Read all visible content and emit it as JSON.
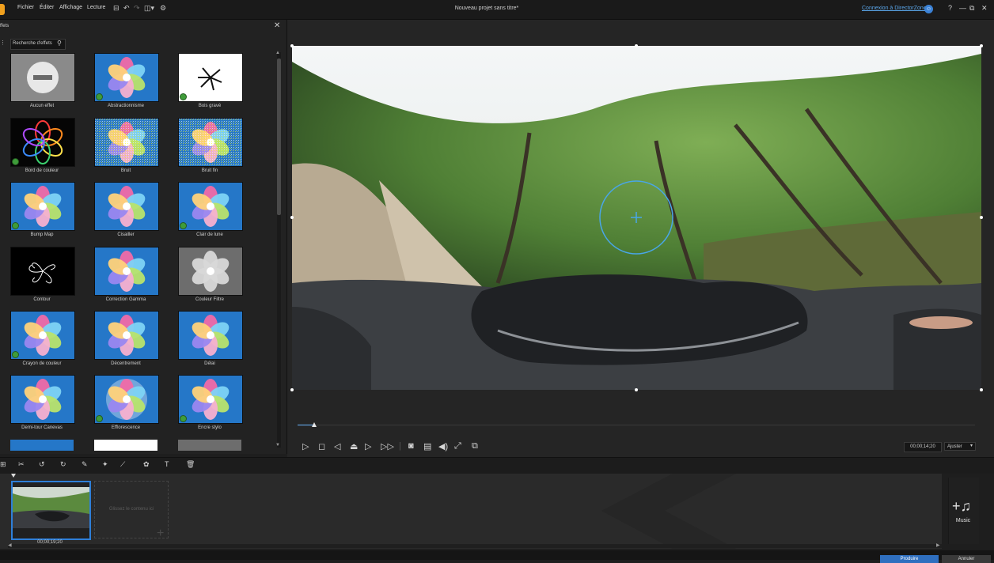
{
  "app": {
    "title": "Nouveau projet sans titre*",
    "menu": [
      "Fichier",
      "Éditer",
      "Affichage",
      "Lecture"
    ],
    "login_link": "Connexion à DirectorZone",
    "window_controls": {
      "help": "?",
      "minimize": "—",
      "restore": "⧉",
      "close": "✕"
    }
  },
  "effects_panel": {
    "title": "ffets",
    "search_placeholder": "Recherche d'effets",
    "items": [
      {
        "label": "Aucun effet",
        "icon": "no-effect-icon",
        "badge": false
      },
      {
        "label": "Abstractionnisme",
        "icon": "flower-thumb",
        "badge": true
      },
      {
        "label": "Bois gravé",
        "icon": "woodcut-thumb",
        "badge": true
      },
      {
        "label": "Bord de couleur",
        "icon": "color-edge-thumb",
        "badge": true
      },
      {
        "label": "Bruit",
        "icon": "noise-thumb",
        "badge": false
      },
      {
        "label": "Bruit fin",
        "icon": "fine-noise-thumb",
        "badge": false
      },
      {
        "label": "Bump Map",
        "icon": "flower-thumb",
        "badge": true
      },
      {
        "label": "Cisailler",
        "icon": "flower-thumb",
        "badge": false
      },
      {
        "label": "Clair de lune",
        "icon": "flower-thumb",
        "badge": true
      },
      {
        "label": "Contour",
        "icon": "contour-thumb",
        "badge": false
      },
      {
        "label": "Correction Gamma",
        "icon": "flower-thumb",
        "badge": false
      },
      {
        "label": "Couleur Filtre",
        "icon": "gray-flower-thumb",
        "badge": false
      },
      {
        "label": "Crayon de couleur",
        "icon": "flower-thumb",
        "badge": true
      },
      {
        "label": "Décentrement",
        "icon": "flower-thumb",
        "badge": false
      },
      {
        "label": "Délai",
        "icon": "flower-thumb",
        "badge": false
      },
      {
        "label": "Demi-tour Canevas",
        "icon": "flower-thumb",
        "badge": false
      },
      {
        "label": "Efflorescence",
        "icon": "glow-flower-thumb",
        "badge": true
      },
      {
        "label": "Encre stylo",
        "icon": "flower-thumb",
        "badge": true
      }
    ]
  },
  "player": {
    "timecode": "00;00;14;20",
    "fit": "Ajuster",
    "progress": 0.025
  },
  "timeline": {
    "clip_time": "00;00;19;20",
    "drop_hint": "Glissez le contenu ici",
    "music_label": "Music"
  },
  "bottom": {
    "produce": "Produire",
    "share": "Annuler"
  },
  "colors": {
    "accent": "#2e7fd8",
    "logo": "#f0a01e",
    "badge": "#3f9c3a",
    "link": "#5aa6ea"
  }
}
